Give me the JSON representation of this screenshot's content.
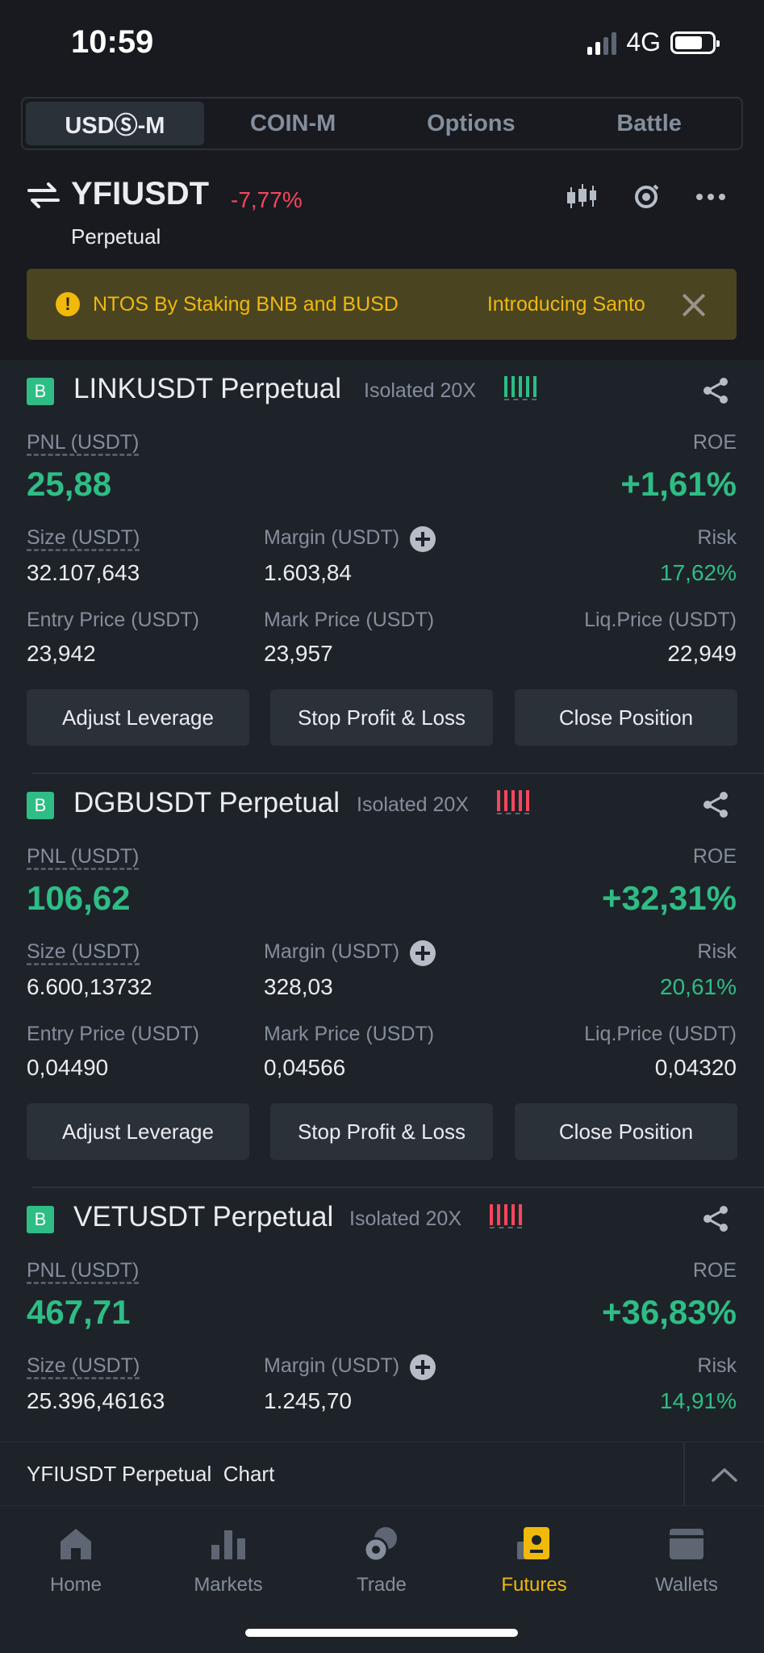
{
  "status_bar": {
    "time": "10:59",
    "network": "4G"
  },
  "tabs": [
    {
      "label": "USDⓈ-M",
      "active": true
    },
    {
      "label": "COIN-M",
      "active": false
    },
    {
      "label": "Options",
      "active": false
    },
    {
      "label": "Battle",
      "active": false
    }
  ],
  "header": {
    "symbol": "YFIUSDT",
    "change": "-7,77%",
    "subtitle": "Perpetual"
  },
  "announcement": {
    "text": "NTOS By Staking BNB and BUSD",
    "text2": "Introducing Santo"
  },
  "positions": [
    {
      "badge": "B",
      "title": "LINKUSDT Perpetual",
      "mode": "Isolated 20X",
      "risk_color": "#2ebd85",
      "pnl_label": "PNL (USDT)",
      "pnl": "25,88",
      "roe_label": "ROE",
      "roe": "+1,61%",
      "size_label": "Size (USDT)",
      "size": "32.107,643",
      "margin_label": "Margin (USDT)",
      "margin": "1.603,84",
      "risk_label": "Risk",
      "risk": "17,62%",
      "entry_label": "Entry Price (USDT)",
      "entry": "23,942",
      "mark_label": "Mark Price (USDT)",
      "mark": "23,957",
      "liq_label": "Liq.Price (USDT)",
      "liq": "22,949",
      "buttons": [
        "Adjust Leverage",
        "Stop Profit & Loss",
        "Close Position"
      ]
    },
    {
      "badge": "B",
      "title": "DGBUSDT Perpetual",
      "mode": "Isolated 20X",
      "risk_color": "#f6465d",
      "pnl_label": "PNL (USDT)",
      "pnl": "106,62",
      "roe_label": "ROE",
      "roe": "+32,31%",
      "size_label": "Size (USDT)",
      "size": "6.600,13732",
      "margin_label": "Margin (USDT)",
      "margin": "328,03",
      "risk_label": "Risk",
      "risk": "20,61%",
      "entry_label": "Entry Price (USDT)",
      "entry": "0,04490",
      "mark_label": "Mark Price (USDT)",
      "mark": "0,04566",
      "liq_label": "Liq.Price (USDT)",
      "liq": "0,04320",
      "buttons": [
        "Adjust Leverage",
        "Stop Profit & Loss",
        "Close Position"
      ]
    },
    {
      "badge": "B",
      "title": "VETUSDT Perpetual",
      "mode": "Isolated 20X",
      "risk_color": "#f6465d",
      "pnl_label": "PNL (USDT)",
      "pnl": "467,71",
      "roe_label": "ROE",
      "roe": "+36,83%",
      "size_label": "Size (USDT)",
      "size": "25.396,46163",
      "margin_label": "Margin (USDT)",
      "margin": "1.245,70",
      "risk_label": "Risk",
      "risk": "14,91%"
    }
  ],
  "chart_bar": {
    "label": "YFIUSDT Perpetual  Chart"
  },
  "bottom_nav": [
    {
      "label": "Home",
      "icon": "home-icon",
      "active": false
    },
    {
      "label": "Markets",
      "icon": "markets-icon",
      "active": false
    },
    {
      "label": "Trade",
      "icon": "trade-icon",
      "active": false
    },
    {
      "label": "Futures",
      "icon": "futures-icon",
      "active": true
    },
    {
      "label": "Wallets",
      "icon": "wallets-icon",
      "active": false
    }
  ],
  "colors": {
    "bg": "#181a20",
    "card": "#1e2329",
    "green": "#2ebd85",
    "red": "#f6465d",
    "accent": "#f0b90b"
  }
}
